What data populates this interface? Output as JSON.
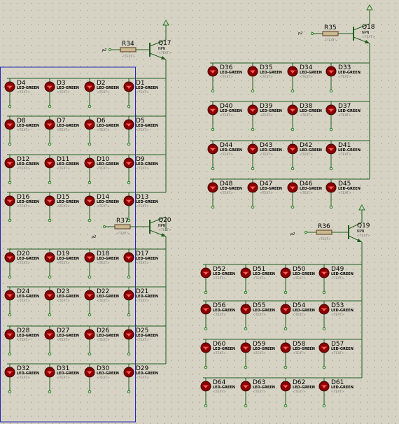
{
  "colors": {
    "background": "#d6d3c4",
    "wire": "#1f5d1f",
    "led_body": "#8b0000",
    "terminal": "#d83030",
    "pin": "#2a8a2a",
    "selection": "#2424b8",
    "power": "#1f7a1f"
  },
  "common": {
    "led_value": "LED-GREEN",
    "text_placeholder": "<TEXT>",
    "transistor_type": "NPN",
    "net_label": "p2"
  },
  "transistors": [
    {
      "ref": "Q17",
      "resistor": "R34"
    },
    {
      "ref": "Q18",
      "resistor": "R35"
    },
    {
      "ref": "Q20",
      "resistor": "R37"
    },
    {
      "ref": "Q19",
      "resistor": "R36"
    }
  ],
  "blocks": [
    {
      "leds": [
        [
          "D4",
          "D3",
          "D2",
          "D1"
        ],
        [
          "D8",
          "D7",
          "D6",
          "D5"
        ],
        [
          "D12",
          "D11",
          "D10",
          "D9"
        ],
        [
          "D16",
          "D15",
          "D14",
          "D13"
        ]
      ]
    },
    {
      "leds": [
        [
          "D36",
          "D35",
          "D34",
          "D33"
        ],
        [
          "D40",
          "D39",
          "D38",
          "D37"
        ],
        [
          "D44",
          "D43",
          "D42",
          "D41"
        ],
        [
          "D48",
          "D47",
          "D46",
          "D45"
        ]
      ]
    },
    {
      "leds": [
        [
          "D20",
          "D19",
          "D18",
          "D17"
        ],
        [
          "D24",
          "D23",
          "D22",
          "D21"
        ],
        [
          "D28",
          "D27",
          "D26",
          "D25"
        ],
        [
          "D32",
          "D31",
          "D30",
          "D29"
        ]
      ]
    },
    {
      "leds": [
        [
          "D52",
          "D51",
          "D50",
          "D49"
        ],
        [
          "D56",
          "D55",
          "D54",
          "D53"
        ],
        [
          "D60",
          "D59",
          "D58",
          "D57"
        ],
        [
          "D64",
          "D63",
          "D62",
          "D61"
        ]
      ]
    }
  ]
}
